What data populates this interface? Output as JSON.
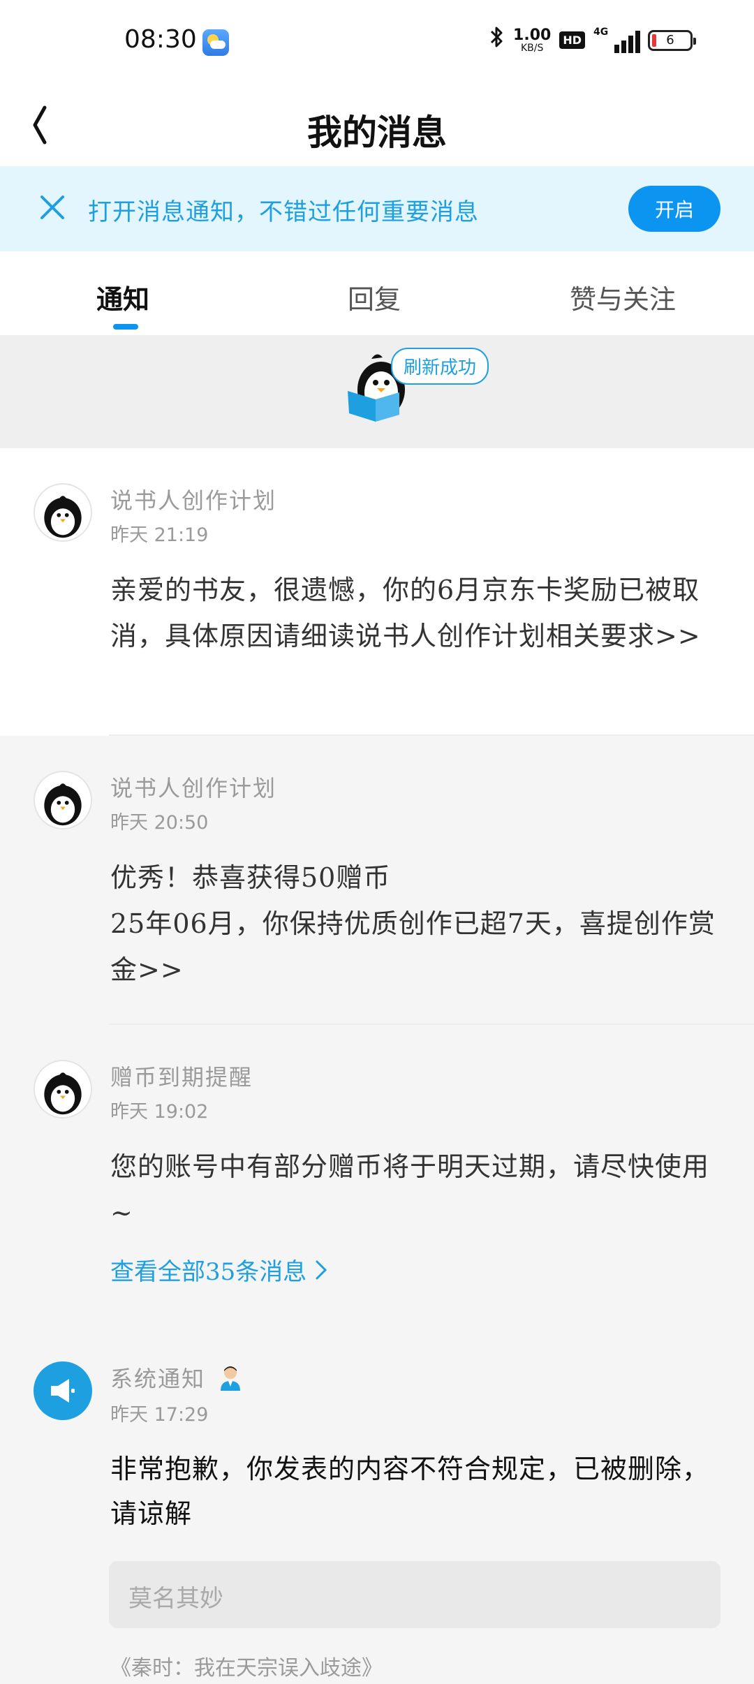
{
  "status_bar": {
    "time": "08:30",
    "weather_icon": "weather-sun-cloud-icon",
    "net_speed_value": "1.00",
    "net_speed_unit": "KB/S",
    "hd_label": "HD",
    "network_label": "4G",
    "battery": "6"
  },
  "header": {
    "title": "我的消息",
    "back_icon": "back-chevron-icon"
  },
  "banner": {
    "text": "打开消息通知，不错过任何重要消息",
    "button_label": "开启",
    "close_icon": "close-icon"
  },
  "tabs": [
    {
      "label": "通知",
      "active": true
    },
    {
      "label": "回复",
      "active": false
    },
    {
      "label": "赞与关注",
      "active": false
    }
  ],
  "refresh": {
    "label": "刷新成功",
    "mascot_icon": "penguin-reading-icon"
  },
  "messages": [
    {
      "sender": "说书人创作计划",
      "time_day": "昨天",
      "time_clock": "21:19",
      "body": "亲爱的书友，很遗憾，你的6月京东卡奖励已被取消，具体原因请细读说书人创作计划相关要求>>"
    },
    {
      "sender": "说书人创作计划",
      "time_day": "昨天",
      "time_clock": "20:50",
      "body_line1": "优秀！恭喜获得50赠币",
      "body_line2": "25年06月，你保持优质创作已超7天，喜提创作赏金>>"
    },
    {
      "sender": "赠币到期提醒",
      "time_day": "昨天",
      "time_clock": "19:02",
      "body": "您的账号中有部分赠币将于明天过期，请尽快使用~",
      "view_all": "查看全部35条消息"
    },
    {
      "sender": "系统通知",
      "time_day": "昨天",
      "time_clock": "17:29",
      "body": "非常抱歉，你发表的内容不符合规定，已被删除，请谅解",
      "quote": "莫名其妙",
      "source": "《秦时：我在天宗误入歧途》",
      "avatar_icon": "megaphone-icon",
      "badge_icon": "official-staff-icon"
    }
  ],
  "colors": {
    "accent": "#0b95f0",
    "banner_bg": "#e3f5fd",
    "link": "#1e9fe0"
  }
}
